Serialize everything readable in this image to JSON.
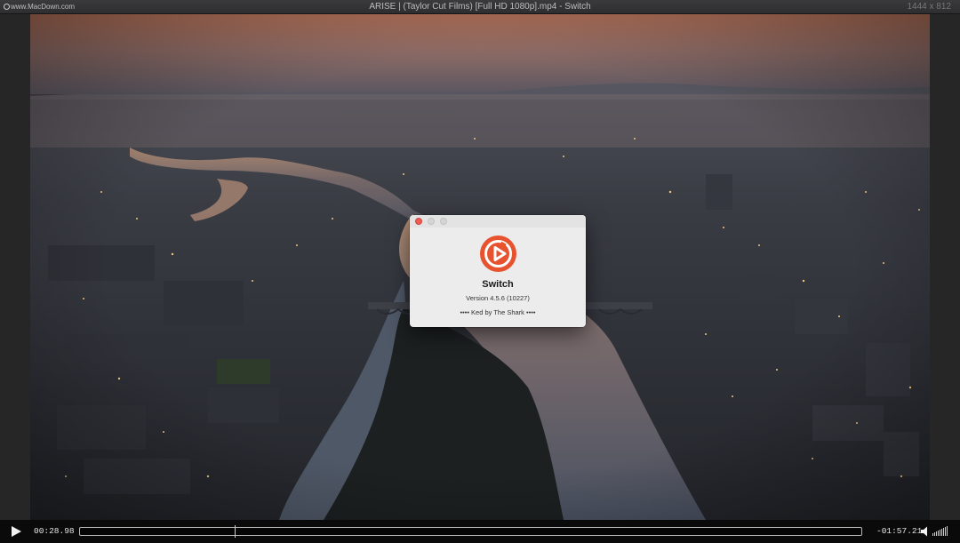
{
  "window": {
    "title": "ARISE | (Taylor Cut Films) [Full HD 1080p].mp4 - Switch",
    "watermark": "www.MacDown.com",
    "dimensions": "1444 x 812"
  },
  "player": {
    "elapsed": "00:28.98",
    "remaining": "-01:57.21",
    "progress_fraction": 0.198,
    "volume_level": 1.0
  },
  "about_dialog": {
    "app_name": "Switch",
    "version": "Version 4.5.6 (10227)",
    "credit": "•••• Ked by The Shark ••••",
    "icon": "switch-play-logo-icon",
    "accent_color": "#e8532f"
  },
  "icons": {
    "play": "play-icon",
    "volume": "speaker-icon",
    "close": "close-icon"
  }
}
